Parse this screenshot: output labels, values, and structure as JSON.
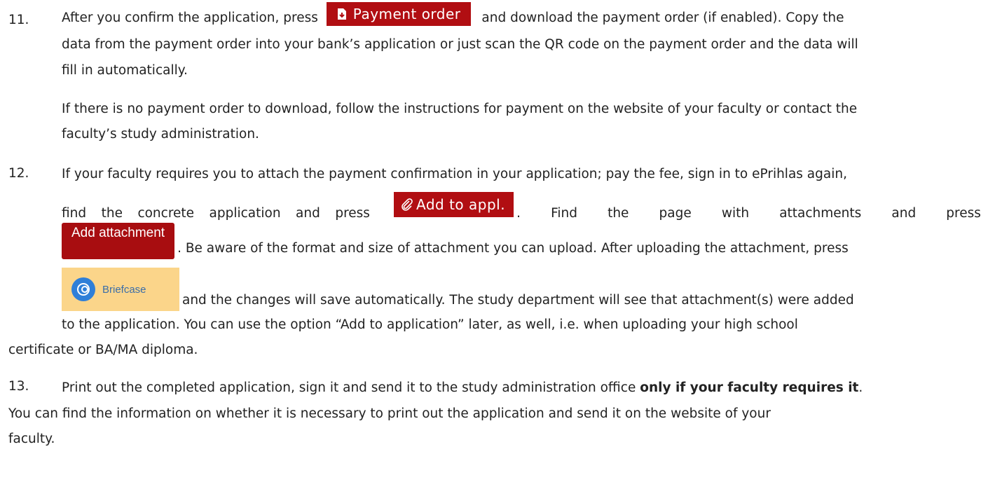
{
  "item11": {
    "number": "11.",
    "pre_button": "After you confirm the application, press",
    "payment_button_label": "Payment order",
    "post_button": "and download the payment order (if enabled). Copy the",
    "line2": "data from the payment order into your bank’s application or just scan the QR code on the payment order and the data will",
    "line3": "fill in automatically.",
    "note_line1": "If there is no payment order to download, follow the instructions for payment on the website of your faculty or contact the",
    "note_line2": "faculty’s study administration."
  },
  "item12": {
    "number": "12.",
    "line1": "If your faculty requires you to attach the payment confirmation in your application; pay the fee, sign in to ePrihlas again,",
    "find_words": [
      "find",
      "the",
      "concrete",
      "application",
      "and",
      "press"
    ],
    "add_to_appl_label": "Add to appl.",
    "after_add_words": [
      ".",
      "Find",
      "the",
      "page",
      "with",
      "attachments",
      "and",
      "press"
    ],
    "add_attachment_label": "Add attachment",
    "after_attachment": ". Be aware of the format and size of attachment you can upload. After uploading the attachment, press",
    "briefcase_label": "Briefcase",
    "after_briefcase": "and the changes will save automatically. The study department will see that attachment(s) were added",
    "line_to_app": "to the application. You can use the option “Add to application” later, as well, i.e. when uploading your high school",
    "line_cert": "certificate or BA/MA diploma."
  },
  "item13": {
    "number": "13.",
    "line1_pre": "Print out the completed application, sign it and send it to the study administration office",
    "line1_bold": "only if your faculty requires it",
    "line1_post": ".",
    "line2": "You can find the information on whether it is necessary to print out the application and send it on the website of your",
    "line3": "faculty."
  },
  "colors": {
    "button_red": "#b10e12",
    "briefcase_bg": "#fbd58a",
    "briefcase_icon": "#2f7fd8"
  }
}
